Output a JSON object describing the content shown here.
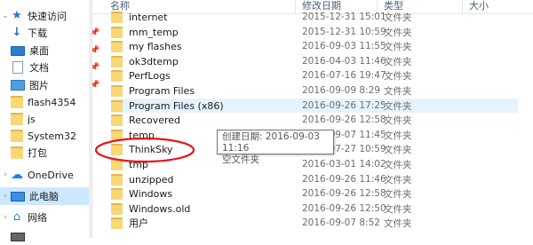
{
  "nav": {
    "quick_access": "快速访问",
    "items": [
      {
        "label": "下载",
        "icon": "download-icon",
        "pinned": true
      },
      {
        "label": "桌面",
        "icon": "desktop-icon",
        "pinned": true
      },
      {
        "label": "文档",
        "icon": "documents-icon",
        "pinned": true
      },
      {
        "label": "图片",
        "icon": "pictures-icon",
        "pinned": true
      },
      {
        "label": "flash4354",
        "icon": "folder-icon",
        "pinned": false
      },
      {
        "label": "js",
        "icon": "folder-icon",
        "pinned": false
      },
      {
        "label": "System32",
        "icon": "folder-icon",
        "pinned": false
      },
      {
        "label": "打包",
        "icon": "folder-icon",
        "pinned": false
      }
    ],
    "onedrive": "OneDrive",
    "this_pc": "此电脑",
    "network": "网络",
    "pin_glyph": "📌"
  },
  "columns": {
    "name": "名称",
    "date": "修改日期",
    "type": "类型",
    "size": "大小"
  },
  "files": [
    {
      "name": "internet",
      "date": "2015-12-31 15:01",
      "type": "文件夹"
    },
    {
      "name": "mm_temp",
      "date": "2015-12-31 10:59",
      "type": "文件夹"
    },
    {
      "name": "my flashes",
      "date": "2016-09-03 11:55",
      "type": "文件夹"
    },
    {
      "name": "ok3dtemp",
      "date": "2016-04-03 11:46",
      "type": "文件夹"
    },
    {
      "name": "PerfLogs",
      "date": "2016-07-16 19:47",
      "type": "文件夹"
    },
    {
      "name": "Program Files",
      "date": "2016-09-09 8:29",
      "type": "文件夹"
    },
    {
      "name": "Program Files (x86)",
      "date": "2016-09-26 17:25",
      "type": "文件夹"
    },
    {
      "name": "Recovered",
      "date": "2016-09-26 12:58",
      "type": "文件夹"
    },
    {
      "name": "temp",
      "date": "2016-09-07 11:45",
      "type": "文件夹"
    },
    {
      "name": "ThinkSky",
      "date": "2016-07-27 10:59",
      "type": "文件夹"
    },
    {
      "name": "tmp",
      "date": "2016-03-01 14:02",
      "type": "文件夹"
    },
    {
      "name": "unzipped",
      "date": "2016-09-26 11:46",
      "type": "文件夹"
    },
    {
      "name": "Windows",
      "date": "2016-09-26 12:58",
      "type": "文件夹"
    },
    {
      "name": "Windows.old",
      "date": "2016-09-26 12:50",
      "type": "文件夹"
    },
    {
      "name": "用户",
      "date": "2016-09-07 8:52",
      "type": "文件夹"
    }
  ],
  "tooltip": {
    "line1": "创建日期: 2016-09-03 11:16",
    "line2": "空文件夹"
  },
  "colors": {
    "selected_row": "#e5f3ff",
    "nav_selected": "#cce8ff",
    "folder": "#f8d775",
    "annotation": "#e8141b"
  }
}
